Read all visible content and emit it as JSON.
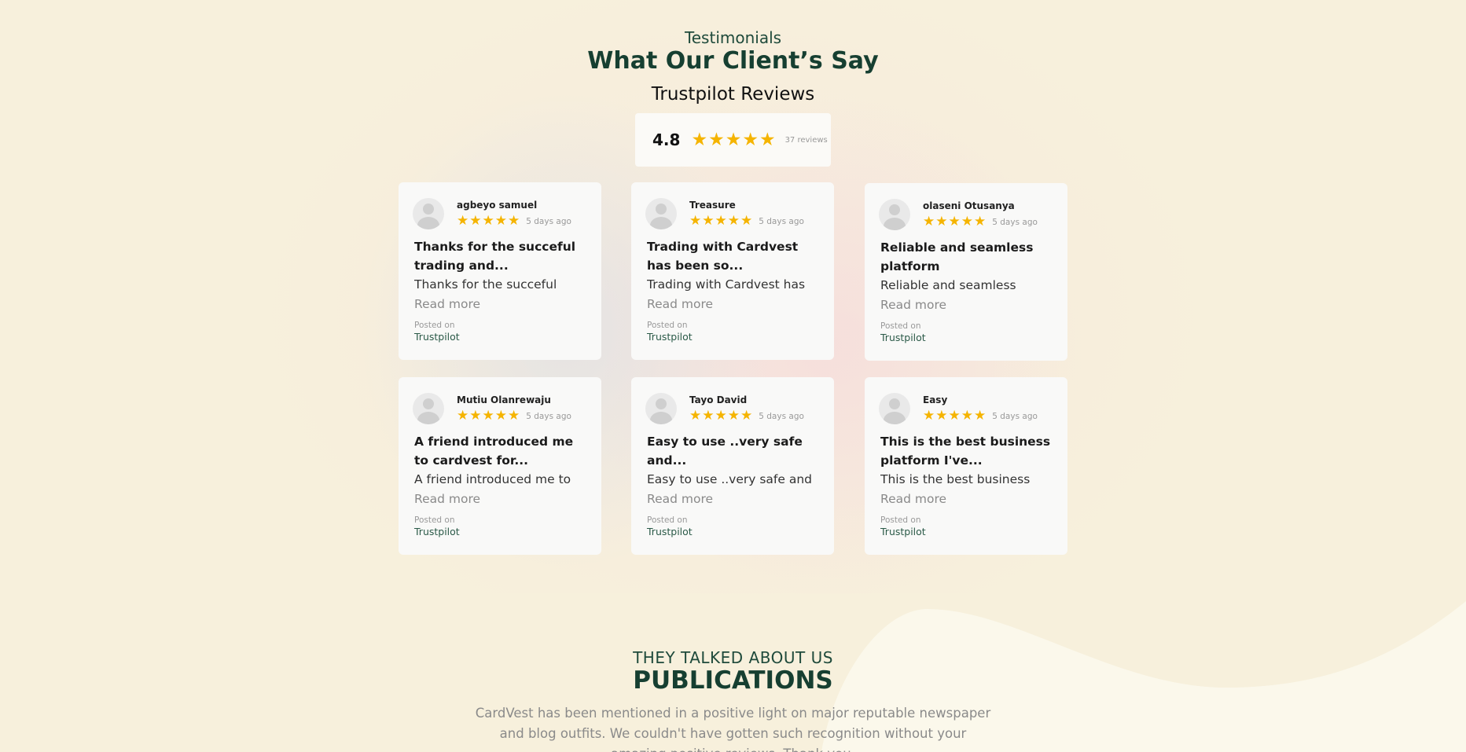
{
  "testimonials": {
    "eyebrow": "Testimonials",
    "title": "What Our Client’s Say",
    "subtitle": "Trustpilot Reviews",
    "summary": {
      "rating": "4.8",
      "stars": 5,
      "count_label": "37 reviews",
      "star_color": "#f5b400"
    },
    "reviews": [
      {
        "name": "agbeyo samuel",
        "stars": 5,
        "time": "5 days ago",
        "title": "Thanks for the succeful trading and...",
        "body": "Thanks for the succeful",
        "read_more": "Read more",
        "posted_label": "Posted on",
        "source": "Trustpilot"
      },
      {
        "name": "Treasure",
        "stars": 5,
        "time": "5 days ago",
        "title": "Trading with Cardvest has been so...",
        "body": "Trading with Cardvest has",
        "read_more": "Read more",
        "posted_label": "Posted on",
        "source": "Trustpilot"
      },
      {
        "name": "olaseni Otusanya",
        "stars": 5,
        "time": "5 days ago",
        "title": "Reliable and seamless platform",
        "body": "Reliable and seamless",
        "read_more": "Read more",
        "posted_label": "Posted on",
        "source": "Trustpilot"
      },
      {
        "name": "Mutiu Olanrewaju",
        "stars": 5,
        "time": "5 days ago",
        "title": "A friend introduced me to cardvest for...",
        "body": "A friend introduced me to",
        "read_more": "Read more",
        "posted_label": "Posted on",
        "source": "Trustpilot"
      },
      {
        "name": "Tayo David",
        "stars": 5,
        "time": "5 days ago",
        "title": "Easy to use ..very safe and...",
        "body": "Easy to use ..very safe and",
        "read_more": "Read more",
        "posted_label": "Posted on",
        "source": "Trustpilot"
      },
      {
        "name": "Easy",
        "stars": 5,
        "time": "5 days ago",
        "title": "This is the best business platform I've...",
        "body": "This is the best business",
        "read_more": "Read more",
        "posted_label": "Posted on",
        "source": "Trustpilot"
      }
    ]
  },
  "publications": {
    "eyebrow": "THEY TALKED ABOUT US",
    "title": "PUBLICATIONS",
    "text": "CardVest has been mentioned in a positive light on major reputable newspaper and blog outfits. We couldn't have gotten such recognition without your amazing positive reviews. Thank you."
  }
}
